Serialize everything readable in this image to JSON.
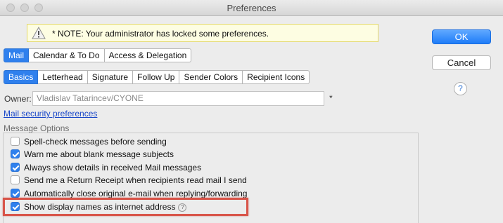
{
  "window": {
    "title": "Preferences"
  },
  "notice": {
    "text": "* NOTE: Your administrator has locked some preferences.",
    "icon": "warning-icon"
  },
  "buttons": {
    "ok": "OK",
    "cancel": "Cancel",
    "help": "?"
  },
  "main_tabs": [
    {
      "label": "Mail",
      "active": true
    },
    {
      "label": "Calendar & To Do",
      "active": false
    },
    {
      "label": "Access & Delegation",
      "active": false
    }
  ],
  "sub_tabs": [
    {
      "label": "Basics",
      "active": true
    },
    {
      "label": "Letterhead",
      "active": false
    },
    {
      "label": "Signature",
      "active": false
    },
    {
      "label": "Follow Up",
      "active": false
    },
    {
      "label": "Sender Colors",
      "active": false
    },
    {
      "label": "Recipient Icons",
      "active": false
    }
  ],
  "owner": {
    "label": "Owner:",
    "value": "Vladislav Tatarincev/CYONE",
    "required_mark": "*"
  },
  "security_link": "Mail security preferences",
  "message_options": {
    "label": "Message Options",
    "items": [
      {
        "label": "Spell-check messages before sending",
        "checked": false
      },
      {
        "label": "Warn me about blank message subjects",
        "checked": true
      },
      {
        "label": "Always show details in received Mail messages",
        "checked": true
      },
      {
        "label": "Send me a Return Receipt when recipients read mail I send",
        "checked": false
      },
      {
        "label": "Automatically close original e-mail when replying/forwarding",
        "checked": true
      },
      {
        "label": "Show display names as internet address",
        "checked": true,
        "help": "?"
      }
    ]
  },
  "colors": {
    "accent": "#2f80ed",
    "highlight_box": "#d8554a",
    "notice_bg": "#fdfde2"
  }
}
